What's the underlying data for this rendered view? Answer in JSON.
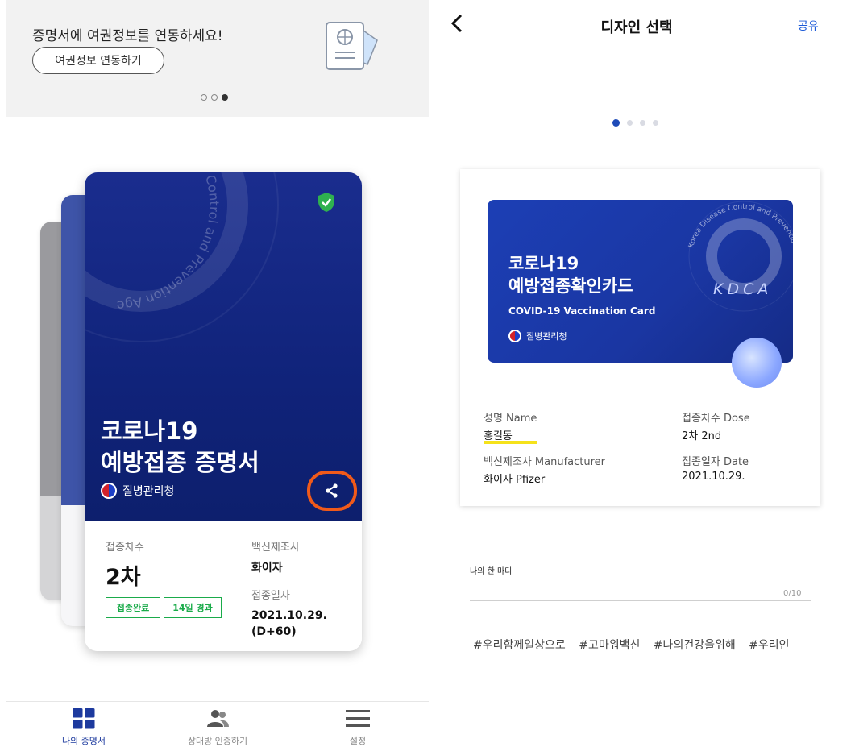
{
  "banner": {
    "text": "증명서에 여권정보를 연동하세요!",
    "button_label": "여권정보 연동하기",
    "pager": {
      "count": 3,
      "active": 3
    }
  },
  "card": {
    "title_line1": "코로나19",
    "title_line2": "예방접종 증명서",
    "org": "질병관리청",
    "dose_label": "접종차수",
    "dose_value": "2차",
    "badge_done": "접종완료",
    "badge_days": "14일 경과",
    "manufacturer_label": "백신제조사",
    "manufacturer_value": "화이자",
    "date_label": "접종일자",
    "date_value_line1": "2021.10.29.",
    "date_value_line2": "(D+60)",
    "bg_text": "Control and Prevention Agency"
  },
  "tabbar": {
    "tabs": [
      {
        "label": "나의 증명서",
        "icon": "grid-icon",
        "active": true
      },
      {
        "label": "상대방 인증하기",
        "icon": "people-icon",
        "active": false
      },
      {
        "label": "설정",
        "icon": "menu-icon",
        "active": false
      }
    ]
  },
  "design": {
    "title": "디자인 선택",
    "share": "공유",
    "pager": {
      "count": 4,
      "active": 1
    }
  },
  "preview": {
    "card_title1": "코로나19",
    "card_title2": "예방접종확인카드",
    "card_subtitle": "COVID-19 Vaccination Card",
    "org": "질병관리청",
    "kdca": "KDCA",
    "ring_text": "Korea Disease Control and Prevention Agency",
    "name_label": "성명 Name",
    "name_value": "홍길동",
    "dose_label": "접종차수 Dose",
    "dose_value": "2차 2nd",
    "mfr_label": "백신제조사 Manufacturer",
    "mfr_value": "화이자 Pfizer",
    "date_label": "접종일자 Date",
    "date_value": "2021.10.29."
  },
  "message": {
    "label": "나의 한 마디",
    "counter": "0/10"
  },
  "hashtags": [
    "#우리함께일상으로",
    "#고마워백신",
    "#나의건강을위해",
    "#우리인"
  ],
  "colors": {
    "card_blue": "#10237a",
    "accent_blue": "#1d5bd8",
    "badge_green": "#1aab4a",
    "highlight_orange": "#f05a1a",
    "highlight_yellow": "#f5e21b"
  }
}
